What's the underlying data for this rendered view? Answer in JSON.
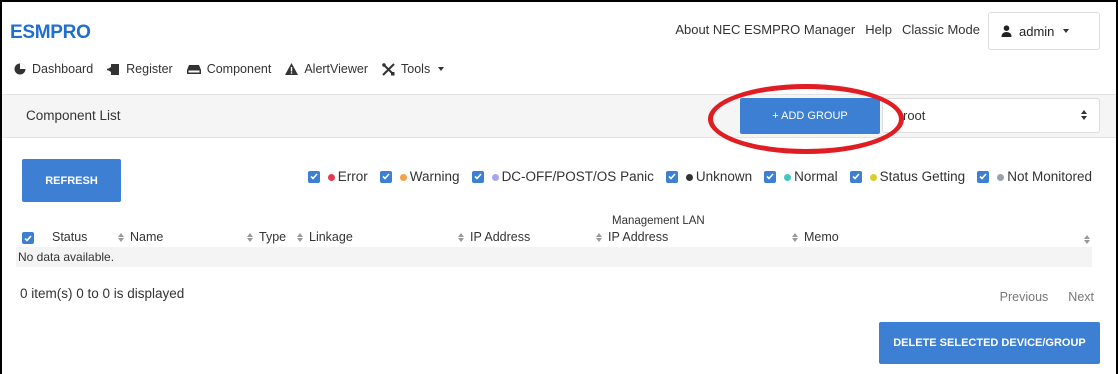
{
  "header": {
    "brand": "ESMPRO",
    "links": [
      "About NEC ESMPRO Manager",
      "Help",
      "Classic Mode"
    ],
    "user": "admin"
  },
  "nav": {
    "items": [
      {
        "label": "Dashboard",
        "icon": "dashboard-icon"
      },
      {
        "label": "Register",
        "icon": "register-icon"
      },
      {
        "label": "Component",
        "icon": "component-icon"
      },
      {
        "label": "AlertViewer",
        "icon": "warning-icon"
      },
      {
        "label": "Tools",
        "icon": "tools-icon",
        "dropdown": true
      }
    ]
  },
  "component_list": {
    "title": "Component List",
    "add_group_label": "+ ADD GROUP",
    "group_select_value": "root"
  },
  "toolbar": {
    "refresh_label": "REFRESH"
  },
  "filters": [
    {
      "label": "Error",
      "color": "#e53950",
      "checked": true
    },
    {
      "label": "Warning",
      "color": "#f5a04a",
      "checked": true
    },
    {
      "label": "DC-OFF/POST/OS Panic",
      "color": "#a9a7ec",
      "checked": true
    },
    {
      "label": "Unknown",
      "color": "#333333",
      "checked": true
    },
    {
      "label": "Normal",
      "color": "#3ec9c0",
      "checked": true
    },
    {
      "label": "Status Getting",
      "color": "#d6cf2c",
      "checked": true
    },
    {
      "label": "Not Monitored",
      "color": "#9aa3ad",
      "checked": true
    }
  ],
  "table": {
    "group_header": "Management LAN",
    "columns": [
      "Status",
      "Name",
      "Type",
      "Linkage",
      "IP Address",
      "IP Address",
      "Memo"
    ],
    "empty_text": "No data available."
  },
  "footer": {
    "count_text": "0 item(s) 0 to 0 is displayed",
    "previous_label": "Previous",
    "next_label": "Next",
    "delete_label": "DELETE SELECTED DEVICE/GROUP"
  },
  "colors": {
    "brand": "#1f6fd1",
    "button": "#3d7fd2",
    "highlight_ring": "#e11d24"
  }
}
